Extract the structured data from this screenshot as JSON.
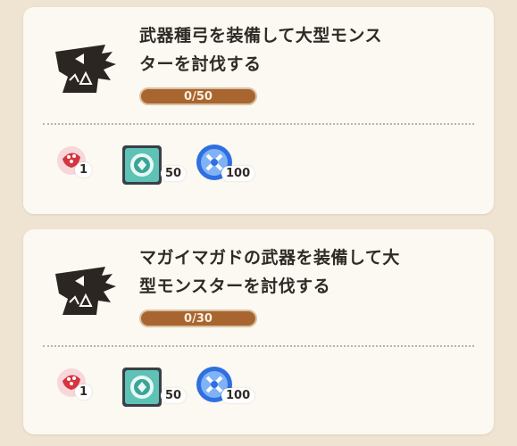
{
  "quests": [
    {
      "title": "武器種弓を装備して大型モンスターを討伐する",
      "title_line1": "武器種弓を装備して大型モンス",
      "title_line2": "ターを討伐する",
      "progress_text": "0/50",
      "progress_fraction": 0,
      "monster_icon": "monster-head-icon",
      "rewards": [
        {
          "icon": "red-ticket-icon",
          "quantity": "1"
        },
        {
          "icon": "green-crystal-icon",
          "quantity": "50"
        },
        {
          "icon": "blue-orb-icon",
          "quantity": "100"
        }
      ]
    },
    {
      "title": "マガイマガドの武器を装備して大型モンスターを討伐する",
      "title_line1": "マガイマガドの武器を装備して大",
      "title_line2": "型モンスターを討伐する",
      "progress_text": "0/30",
      "progress_fraction": 0,
      "monster_icon": "monster-head-icon",
      "rewards": [
        {
          "icon": "red-ticket-icon",
          "quantity": "1"
        },
        {
          "icon": "green-crystal-icon",
          "quantity": "50"
        },
        {
          "icon": "blue-orb-icon",
          "quantity": "100"
        }
      ]
    }
  ],
  "colors": {
    "background": "#efe4d2",
    "card": "#fcf8f2",
    "progress_fill": "#a86530",
    "text": "#2e2a26"
  }
}
